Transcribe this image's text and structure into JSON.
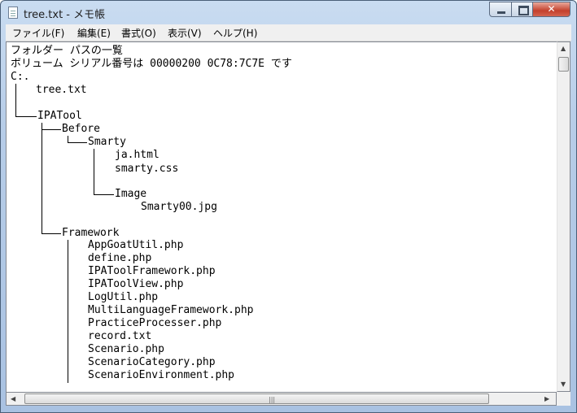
{
  "window": {
    "title": "tree.txt - メモ帳"
  },
  "menu": [
    "ファイル(F)",
    "編集(E)",
    "書式(O)",
    "表示(V)",
    "ヘルプ(H)"
  ],
  "editor": {
    "lines": [
      "フォルダー パスの一覧",
      "ボリューム シリアル番号は 00000200 0C78:7C7E です",
      "C:.",
      "tree.txt",
      "IPATool",
      "Before",
      "Smarty",
      "ja.html",
      "smarty.css",
      "Image",
      "Smarty00.jpg",
      "Framework",
      "AppGoatUtil.php",
      "define.php",
      "IPAToolFramework.php",
      "IPAToolView.php",
      "LogUtil.php",
      "MultiLanguageFramework.php",
      "PracticeProcesser.php",
      "record.txt",
      "Scenario.php",
      "ScenarioCategory.php",
      "ScenarioEnvironment.php"
    ]
  },
  "colors": {
    "titlebar": "#b7cde8",
    "close_button": "#c4402c",
    "menubar": "#f0f0f0"
  }
}
